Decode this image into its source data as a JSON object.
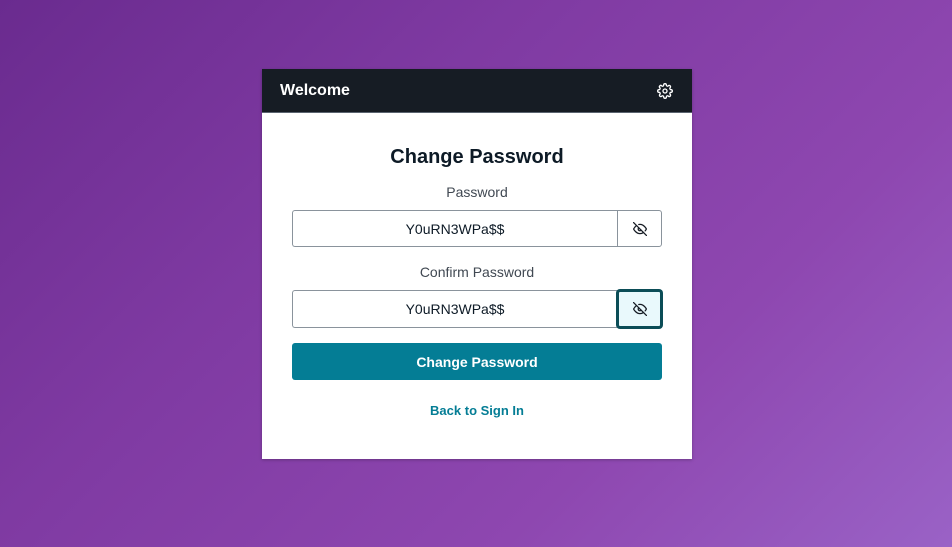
{
  "header": {
    "title": "Welcome",
    "settings_icon": "gear-icon"
  },
  "form": {
    "heading": "Change Password",
    "password": {
      "label": "Password",
      "value": "Y0uRN3WPa$$",
      "toggle_icon": "eye-slash-icon"
    },
    "confirm_password": {
      "label": "Confirm Password",
      "value": "Y0uRN3WPa$$",
      "toggle_icon": "eye-slash-icon"
    },
    "submit_label": "Change Password",
    "back_link": "Back to Sign In"
  },
  "colors": {
    "header_bg": "#161c24",
    "primary": "#047d95",
    "focus_border": "#0b4d57"
  }
}
